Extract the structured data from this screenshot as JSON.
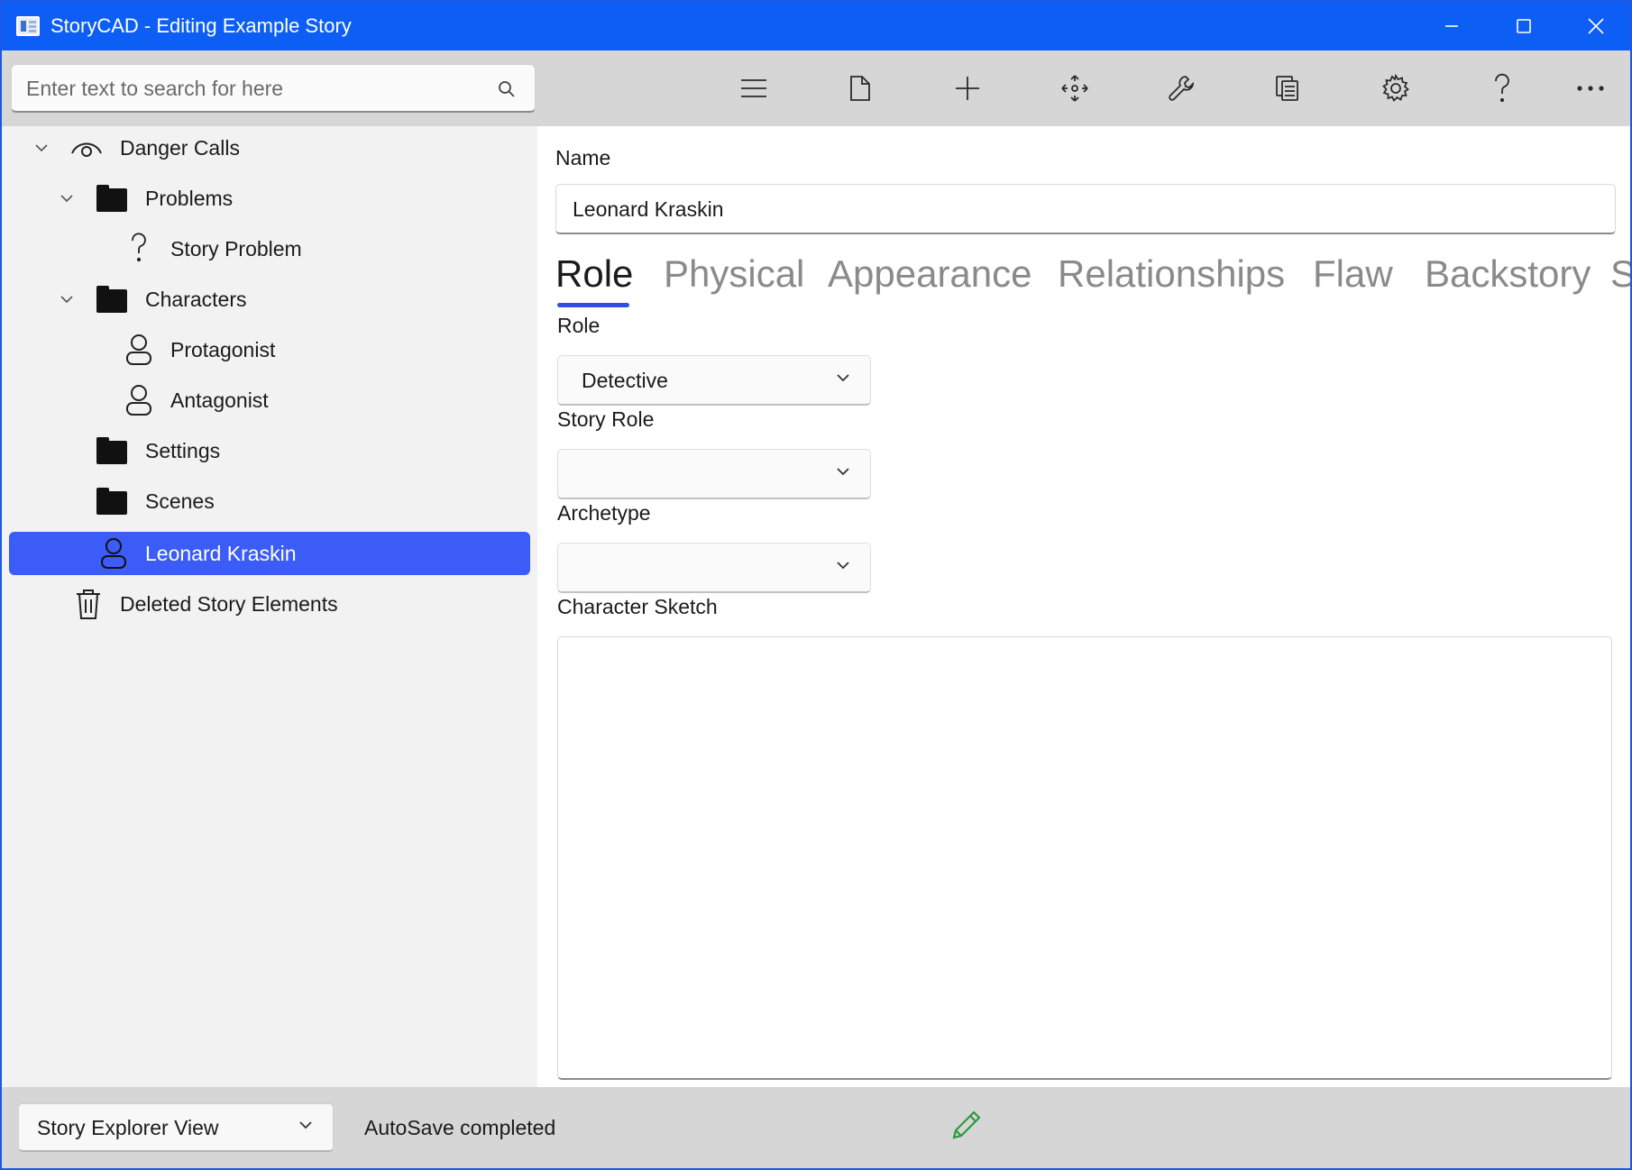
{
  "window": {
    "title": "StoryCAD - Editing Example Story",
    "controls": [
      "minimize",
      "maximize",
      "close"
    ]
  },
  "toolbar": {
    "search_placeholder": "Enter text to search for here",
    "buttons": [
      {
        "icon": "hamburger-menu-icon"
      },
      {
        "icon": "document-icon"
      },
      {
        "icon": "add-icon"
      },
      {
        "icon": "move-icon"
      },
      {
        "icon": "wrench-icon"
      },
      {
        "icon": "copy-icon"
      },
      {
        "icon": "settings-icon"
      },
      {
        "icon": "help-icon"
      },
      {
        "icon": "more-icon"
      }
    ]
  },
  "tree": {
    "nodes": [
      {
        "label": "Danger Calls",
        "icon": "eye-icon",
        "expanded": true
      },
      {
        "label": "Problems",
        "icon": "folder-icon",
        "expanded": true
      },
      {
        "label": "Story Problem",
        "icon": "question-icon"
      },
      {
        "label": "Characters",
        "icon": "folder-icon",
        "expanded": true
      },
      {
        "label": "Protagonist",
        "icon": "person-icon"
      },
      {
        "label": "Antagonist",
        "icon": "person-icon"
      },
      {
        "label": "Settings",
        "icon": "folder-icon"
      },
      {
        "label": "Scenes",
        "icon": "folder-icon"
      },
      {
        "label": "Leonard Kraskin",
        "icon": "person-icon",
        "selected": true
      },
      {
        "label": "Deleted Story Elements",
        "icon": "trash-icon"
      }
    ]
  },
  "editor": {
    "name_label": "Name",
    "name_value": "Leonard Kraskin",
    "tabs": [
      "Role",
      "Physical",
      "Appearance",
      "Relationships",
      "Flaw",
      "Backstory",
      "S"
    ],
    "active_tab": "Role",
    "role_label": "Role",
    "role_value": "Detective",
    "story_role_label": "Story Role",
    "story_role_value": "",
    "archetype_label": "Archetype",
    "archetype_value": "",
    "sketch_label": "Character Sketch",
    "sketch_value": ""
  },
  "statusbar": {
    "view_selector": "Story Explorer View",
    "message": "AutoSave completed",
    "edit_indicator_icon": "pencil-icon",
    "edit_indicator_color": "#2e9a3a"
  },
  "colors": {
    "titlebar": "#0d5ef5",
    "selection": "#3c5cf7",
    "tab_underline": "#2e4fe0"
  }
}
